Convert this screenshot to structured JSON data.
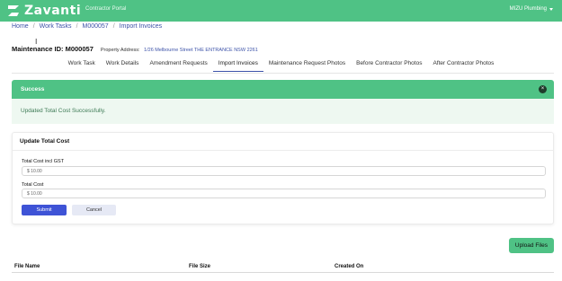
{
  "header": {
    "brand": "Zavanti",
    "portal_label": "Contractor Portal",
    "user_menu": "MIZU Plumbing",
    "brand_color": "#4fc285"
  },
  "breadcrumb": [
    "Home",
    "Work Tasks",
    "M000057",
    "Import Invoices"
  ],
  "maintenance": {
    "id_label": "Maintenance ID: M000057",
    "property_label": "Property Address:",
    "property_value": "1/26 Melbourne Street THE ENTRANCE NSW 2261"
  },
  "tabs": [
    {
      "label": "Work Task",
      "active": false
    },
    {
      "label": "Work Details",
      "active": false
    },
    {
      "label": "Amendment Requests",
      "active": false
    },
    {
      "label": "Import Invoices",
      "active": true
    },
    {
      "label": "Maintenance Request Photos",
      "active": false
    },
    {
      "label": "Before Contractor Photos",
      "active": false
    },
    {
      "label": "After Contractor Photos",
      "active": false
    }
  ],
  "alert": {
    "title": "Success",
    "message": "Updated Total Cost Successfully.",
    "close_icon": "close-circle-icon"
  },
  "form": {
    "title": "Update Total Cost",
    "total_incl_gst_label": "Total Cost incl GST",
    "total_incl_gst_value": "$ 10.00",
    "total_label": "Total Cost",
    "total_value": "$ 10.00",
    "submit_label": "Submit",
    "cancel_label": "Cancel"
  },
  "upload": {
    "label": "Upload Files"
  },
  "files_table": {
    "columns": [
      "File Name",
      "File Size",
      "Created On"
    ]
  }
}
